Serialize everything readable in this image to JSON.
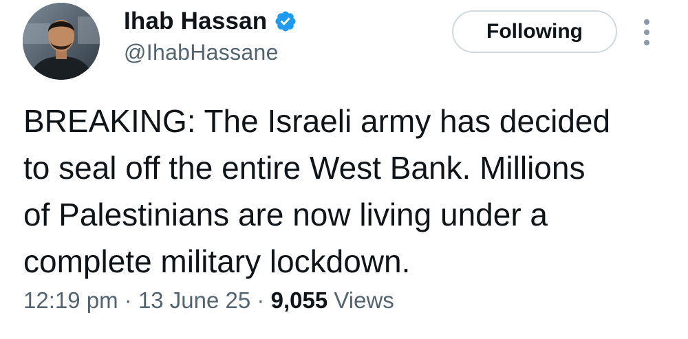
{
  "author": {
    "display_name": "Ihab Hassan",
    "handle": "@IhabHassane",
    "verified_icon": "verified-badge-icon",
    "accent_color": "#1d9bf0"
  },
  "actions": {
    "follow_label": "Following",
    "more_icon": "more-vertical-icon"
  },
  "tweet": {
    "text": "BREAKING: The Israeli army has decided\nto seal off the entire West Bank. Millions\nof Palestinians are now living under a\ncomplete military lockdown.",
    "time": "12:19 pm",
    "date": "13 June 25",
    "separator": "·",
    "views_count": "9,055",
    "views_label": "Views"
  }
}
